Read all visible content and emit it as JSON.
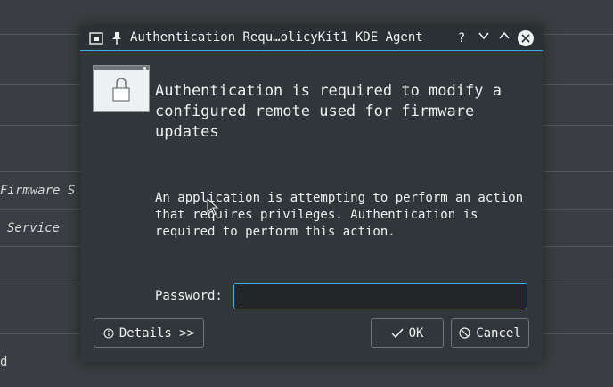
{
  "background": {
    "label_firmware": "Firmware S",
    "label_service": "Service",
    "label_d": "d"
  },
  "dialog": {
    "title": "Authentication Requ…olicyKit1 KDE Agent",
    "titlebar_buttons": {
      "help": "?",
      "minimize_icon": "chevron-down-icon",
      "maximize_icon": "chevron-up-icon",
      "close_icon": "close-icon"
    },
    "headline": "Authentication is required to modify a configured remote used for firmware updates",
    "body": "An application is attempting to perform an action that requires privileges. Authentication is required to perform this action.",
    "password_label": "Password:",
    "password_value": "",
    "details_label": "Details >>",
    "ok_label": "OK",
    "cancel_label": "Cancel"
  },
  "colors": {
    "accent": "#3daee9",
    "dialog_bg": "#31363b",
    "text": "#eff0f1"
  }
}
